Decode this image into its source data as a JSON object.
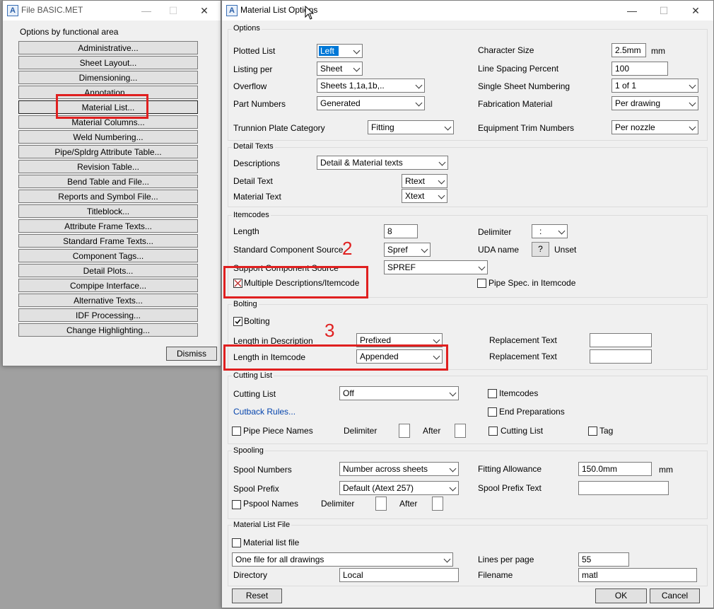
{
  "left_window": {
    "title": "File BASIC.MET",
    "heading": "Options by functional area",
    "buttons": [
      "Administrative...",
      "Sheet Layout...",
      "Dimensioning...",
      "Annotation...",
      "Material List...",
      "Material Columns...",
      "Weld Numbering...",
      "Pipe/Spldrg Attribute Table...",
      "Revision Table...",
      "Bend Table and File...",
      "Reports and Symbol File...",
      "Titleblock...",
      "Attribute Frame Texts...",
      "Standard Frame Texts...",
      "Component Tags...",
      "Detail Plots...",
      "Compipe Interface...",
      "Alternative Texts...",
      "IDF Processing...",
      "Change Highlighting..."
    ],
    "dismiss": "Dismiss"
  },
  "right_window": {
    "title": "Material List Options",
    "options": {
      "label": "Options",
      "plotted_list": {
        "label": "Plotted List",
        "value": "Left"
      },
      "listing_per": {
        "label": "Listing per",
        "value": "Sheet"
      },
      "overflow": {
        "label": "Overflow",
        "value": "Sheets 1,1a,1b,.."
      },
      "part_numbers": {
        "label": "Part Numbers",
        "value": "Generated"
      },
      "trunnion": {
        "label": "Trunnion Plate Category",
        "value": "Fitting"
      },
      "char_size": {
        "label": "Character Size",
        "value": "2.5mm",
        "unit": "mm"
      },
      "line_spacing": {
        "label": "Line Spacing Percent",
        "value": "100"
      },
      "single_sheet": {
        "label": "Single Sheet Numbering",
        "value": "1 of 1"
      },
      "fab_material": {
        "label": "Fabrication Material",
        "value": "Per drawing"
      },
      "equip_trim": {
        "label": "Equipment Trim Numbers",
        "value": "Per nozzle"
      }
    },
    "detail_texts": {
      "label": "Detail Texts",
      "descriptions": {
        "label": "Descriptions",
        "value": "Detail & Material texts"
      },
      "detail_text": {
        "label": "Detail Text",
        "value": "Rtext"
      },
      "material_text": {
        "label": "Material Text",
        "value": "Xtext"
      }
    },
    "itemcodes": {
      "label": "Itemcodes",
      "length": {
        "label": "Length",
        "value": "8"
      },
      "std_source": {
        "label": "Standard Component Source",
        "value": "Spref"
      },
      "sup_source": {
        "label": "Support Component Source",
        "value": "SPREF"
      },
      "multi_desc": "Multiple Descriptions/Itemcode",
      "delimiter": {
        "label": "Delimiter",
        "value": ":"
      },
      "uda": {
        "label": "UDA name",
        "btn": "?",
        "value": "Unset"
      },
      "pipe_spec": "Pipe Spec. in Itemcode"
    },
    "bolting": {
      "label": "Bolting",
      "bolting_chk": "Bolting",
      "len_desc": {
        "label": "Length in Description",
        "value": "Prefixed"
      },
      "len_item": {
        "label": "Length in Itemcode",
        "value": "Appended"
      },
      "repl1": "Replacement Text",
      "repl2": "Replacement Text"
    },
    "cutting": {
      "label": "Cutting List",
      "cutting_list": {
        "label": "Cutting List",
        "value": "Off"
      },
      "cutback": "Cutback Rules...",
      "pipe_piece": "Pipe Piece Names",
      "delimiter": "Delimiter",
      "after": "After",
      "itemcodes": "Itemcodes",
      "end_prep": "End Preparations",
      "cutting_chk": "Cutting List",
      "tag": "Tag"
    },
    "spooling": {
      "label": "Spooling",
      "spool_numbers": {
        "label": "Spool Numbers",
        "value": "Number across sheets"
      },
      "spool_prefix": {
        "label": "Spool Prefix",
        "value": "Default (Atext 257)"
      },
      "pspool": "Pspool Names",
      "delimiter": "Delimiter",
      "after": "After",
      "fitting_allowance": {
        "label": "Fitting Allowance",
        "value": "150.0mm",
        "unit": "mm"
      },
      "spool_prefix_text": "Spool Prefix Text"
    },
    "mlfile": {
      "label": "Material List File",
      "file_chk": "Material list file",
      "per_file": "One file for all drawings",
      "directory": {
        "label": "Directory",
        "value": "Local"
      },
      "lines_per_page": {
        "label": "Lines per page",
        "value": "55"
      },
      "filename": {
        "label": "Filename",
        "value": "matl"
      }
    },
    "reset": "Reset",
    "ok": "OK",
    "cancel": "Cancel"
  },
  "annotations": {
    "num2": "2",
    "num3": "3"
  },
  "colors": {
    "highlight": "#e02020",
    "selection": "#0078d7",
    "link": "#0645ad"
  }
}
